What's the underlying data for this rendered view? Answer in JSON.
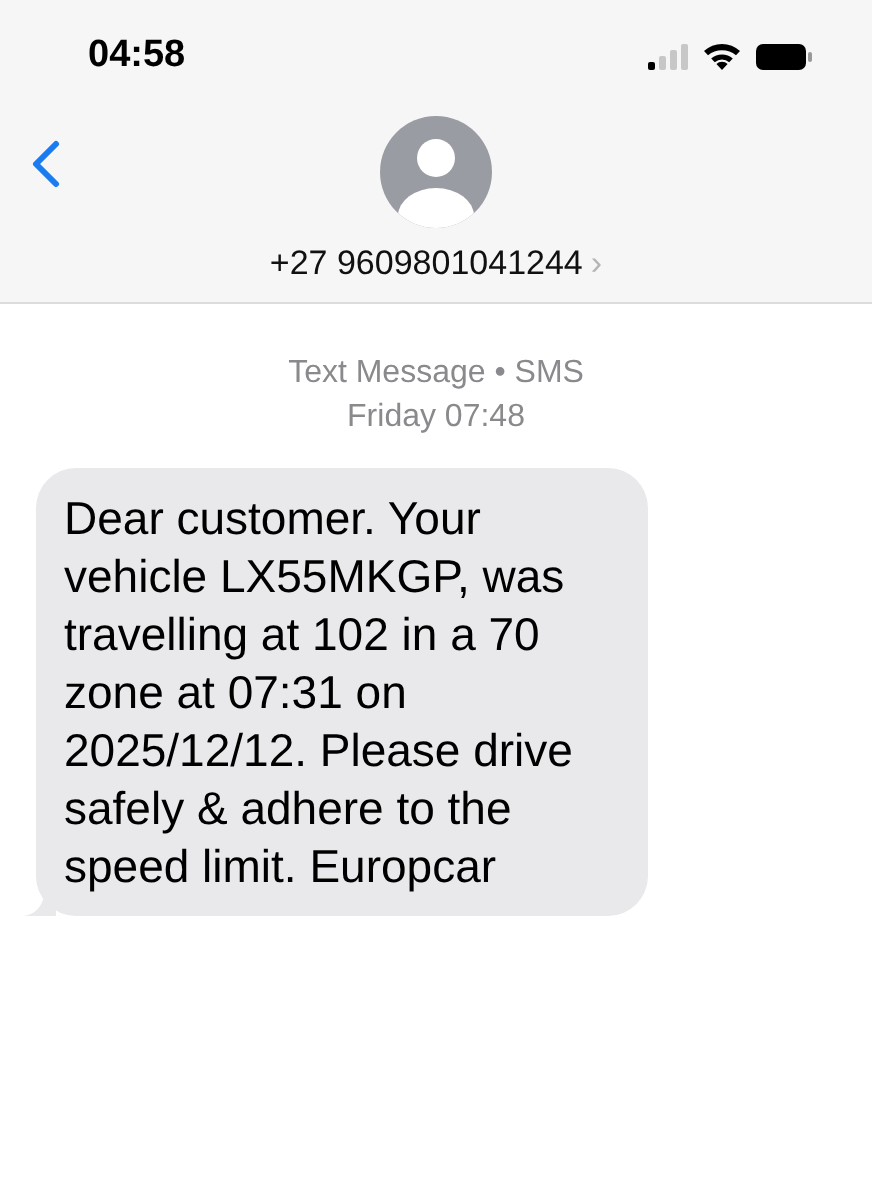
{
  "status_bar": {
    "time": "04:58"
  },
  "header": {
    "contact": "+27 9609801041244",
    "chevron": "›"
  },
  "conversation": {
    "service": "Text Message • SMS",
    "timestamp": "Friday 07:48",
    "messages": [
      {
        "kind": "incoming",
        "text": "Dear customer. Your vehicle LX55MKGP, was travelling at 102 in a 70 zone at 07:31 on 2025/12/12. Please drive safely & adhere to the speed limit. Europcar"
      }
    ]
  }
}
